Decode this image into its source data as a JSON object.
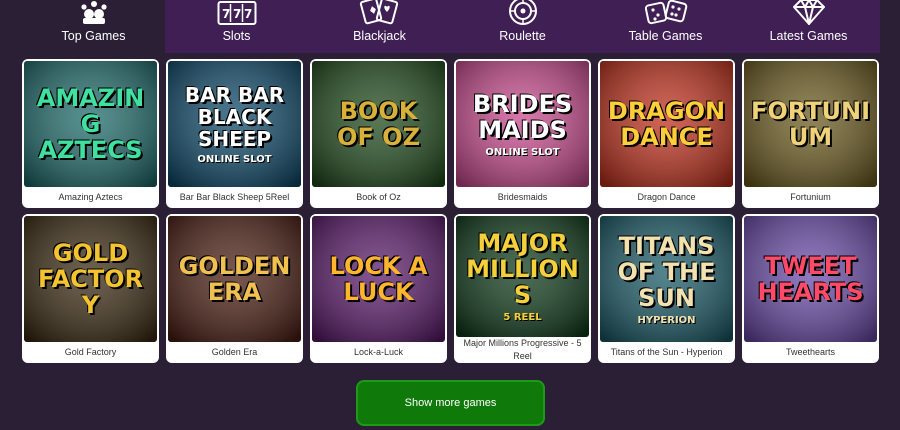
{
  "nav": {
    "tabs": [
      {
        "label": "Top Games",
        "icon": "crown-icon"
      },
      {
        "label": "Slots",
        "icon": "slot-machine-icon"
      },
      {
        "label": "Blackjack",
        "icon": "playing-cards-icon"
      },
      {
        "label": "Roulette",
        "icon": "roulette-wheel-icon"
      },
      {
        "label": "Table Games",
        "icon": "dice-icon"
      },
      {
        "label": "Latest Games",
        "icon": "diamond-icon"
      }
    ],
    "active_index": 0
  },
  "games": [
    {
      "title": "Amazing Aztecs",
      "art_text": "AMAZING AZTECS",
      "bg": "#1e6b6a",
      "fg": "#3fe0a0"
    },
    {
      "title": "Bar Bar Black Sheep 5Reel",
      "art_text": "BAR BAR BLACK SHEEP",
      "sub_text": "ONLINE SLOT",
      "bg": "#0e4a6a",
      "fg": "#ffffff"
    },
    {
      "title": "Book of Oz",
      "art_text": "BOOK OF OZ",
      "bg": "#1f4a1c",
      "fg": "#d8b13a"
    },
    {
      "title": "Bridesmaids",
      "art_text": "BRIDES MAIDS",
      "sub_text": "ONLINE SLOT",
      "bg": "#c94a8e",
      "fg": "#ffffff"
    },
    {
      "title": "Dragon Dance",
      "art_text": "DRAGON DANCE",
      "bg": "#c0301c",
      "fg": "#ffcf3a"
    },
    {
      "title": "Fortunium",
      "art_text": "FORTUNIUM",
      "bg": "#6b5a1e",
      "fg": "#f0d27a"
    },
    {
      "title": "Gold Factory",
      "art_text": "GOLD FACTORY",
      "bg": "#3a2a12",
      "fg": "#f4c430"
    },
    {
      "title": "Golden Era",
      "art_text": "GOLDEN ERA",
      "bg": "#4a1e12",
      "fg": "#f0c050"
    },
    {
      "title": "Lock-a-Luck",
      "art_text": "LOCK A LUCK",
      "bg": "#5a1a6a",
      "fg": "#ffb52e"
    },
    {
      "title": "Major Millions Progressive - 5 Reel",
      "art_text": "MAJOR MILLIONS",
      "sub_text": "5 REEL",
      "bg": "#0e3a1a",
      "fg": "#f4d03a"
    },
    {
      "title": "Titans of the Sun - Hyperion",
      "art_text": "TITANS OF THE SUN",
      "sub_text": "HYPERION",
      "bg": "#1a5a66",
      "fg": "#f2e2b0"
    },
    {
      "title": "Tweethearts",
      "art_text": "TWEET HEARTS",
      "bg": "#6a4aa8",
      "fg": "#ff4a6a"
    }
  ],
  "show_more_label": "Show more games",
  "colors": {
    "background": "#2a1f35",
    "nav": "#3f1f54",
    "button": "#0f7a0a"
  }
}
